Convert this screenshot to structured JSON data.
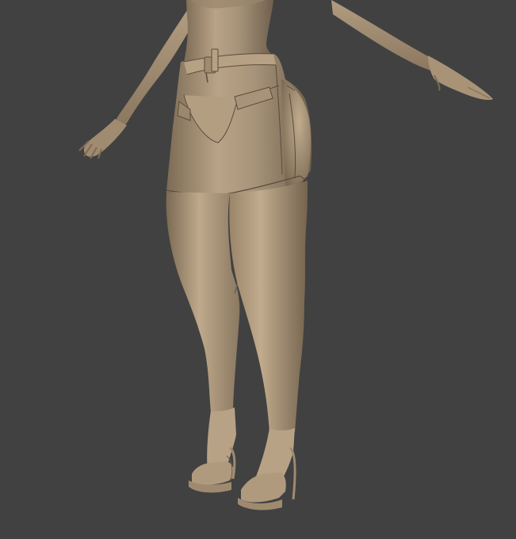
{
  "viewport": {
    "background_color": "#414141",
    "model": {
      "material_color": "#a89377",
      "highlight_color": "#c9b497",
      "shadow_color": "#6f5f4b",
      "seam_color": "#5a4c3c"
    }
  }
}
